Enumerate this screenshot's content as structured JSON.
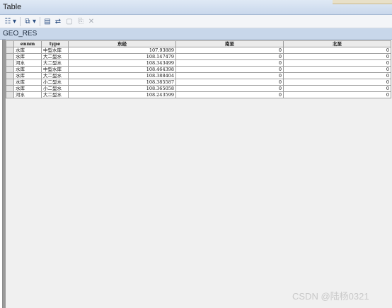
{
  "window": {
    "title": "Table"
  },
  "toolbar": {
    "buttons": [
      {
        "name": "table-options-icon",
        "glyph": "☷"
      },
      {
        "name": "table-options-dropdown-icon",
        "glyph": "▾"
      },
      {
        "name": "related-tables-icon",
        "glyph": "⧉"
      },
      {
        "name": "related-tables-dropdown-icon",
        "glyph": "▾"
      },
      {
        "name": "select-by-attributes-icon",
        "glyph": "▤"
      },
      {
        "name": "switch-selection-icon",
        "glyph": "⇄"
      },
      {
        "name": "clear-selection-icon",
        "glyph": "▢"
      },
      {
        "name": "zoom-to-selected-icon",
        "glyph": "⎘"
      },
      {
        "name": "delete-selected-icon",
        "glyph": "✕"
      }
    ]
  },
  "tab": {
    "label": "GEO_RES"
  },
  "table": {
    "headers": [
      "",
      "ennm",
      "type",
      "东经",
      "南至",
      "北至"
    ],
    "rows": [
      [
        "水库",
        "中型水库",
        "107.93889",
        "0",
        "0"
      ],
      [
        "水库",
        "大二型水",
        "108.147479",
        "0",
        "0"
      ],
      [
        "河水",
        "大二型水",
        "108.343499",
        "0",
        "0"
      ],
      [
        "水库",
        "中型水库",
        "108.464398",
        "0",
        "0"
      ],
      [
        "水库",
        "大二型水",
        "108.388404",
        "0",
        "0"
      ],
      [
        "水库",
        "小二型水",
        "108.385587",
        "0",
        "0"
      ],
      [
        "水库",
        "小二型水",
        "108.365058",
        "0",
        "0"
      ],
      [
        "河水",
        "大二型水",
        "108.243599",
        "0",
        "0"
      ]
    ]
  },
  "watermark": {
    "text": "CSDN @陆杨0321"
  }
}
